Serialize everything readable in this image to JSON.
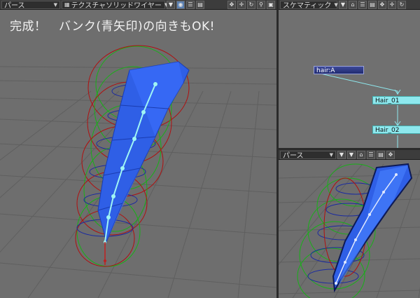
{
  "main_viewport": {
    "view_mode": "パース",
    "shading_mode": "テクスチャソリッドワイヤー",
    "title_text": "完成！　バンク(青矢印)の向きもOK!"
  },
  "schematic": {
    "view_mode": "スケマティック",
    "nodes": [
      {
        "label": "hair:A"
      },
      {
        "label": "Hair_01"
      },
      {
        "label": "Hair_02"
      }
    ]
  },
  "bottom_viewport": {
    "view_mode": "パース"
  },
  "colors": {
    "viewport_bg": "#6e6e6e",
    "header_bg": "#3c3c3c",
    "mesh_blue": "#2f5fe6",
    "bone_cyan": "#9ff5f5",
    "ring_red": "#b01010",
    "ring_green": "#18b018",
    "ring_blue": "#1a2aa0",
    "node_cyan": "#8ee8ee"
  },
  "icons": [
    "camera-icon",
    "list-icon",
    "save-icon",
    "move-icon",
    "pan-icon",
    "rotate-icon",
    "zoom-icon",
    "maximize-icon",
    "home-icon"
  ]
}
